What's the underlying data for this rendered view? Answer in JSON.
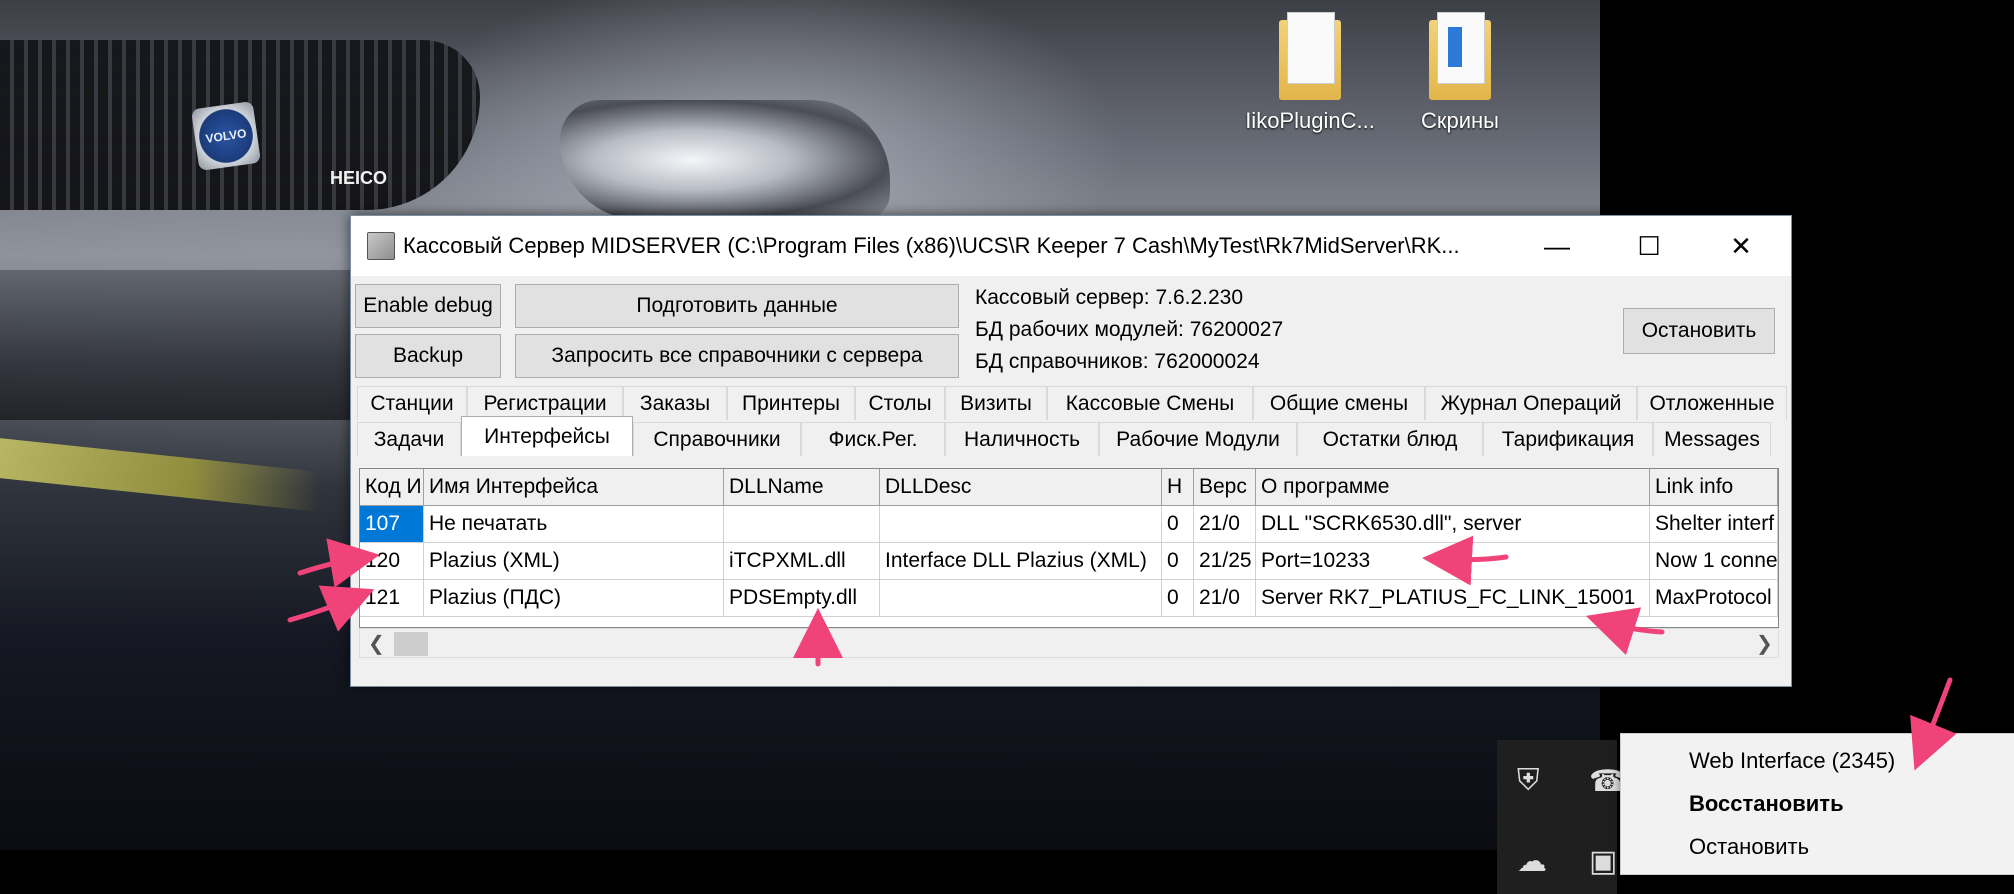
{
  "desktop": {
    "icons": [
      {
        "label": "IikoPluginC..."
      },
      {
        "label": "Скрины"
      }
    ],
    "wallpaper_brand": "HEICO",
    "wallpaper_logo": "VOLVO"
  },
  "window": {
    "title": "Кассовый Сервер MIDSERVER (C:\\Program Files (x86)\\UCS\\R Keeper 7 Cash\\MyTest\\Rk7MidServer\\RK...",
    "controls": {
      "minimize": "—",
      "maximize": "☐",
      "close": "✕"
    },
    "buttons": {
      "enable_debug": "Enable debug",
      "backup": "Backup",
      "prepare_data": "Подготовить данные",
      "request_refs": "Запросить все справочники с сервера",
      "stop": "Остановить"
    },
    "info": {
      "server_version": "Кассовый сервер: 7.6.2.230",
      "db_modules": "БД рабочих модулей: 76200027",
      "db_refs": "БД справочников: 762000024"
    },
    "tabs_row1": [
      "Станции",
      "Регистрации",
      "Заказы",
      "Принтеры",
      "Столы",
      "Визиты",
      "Кассовые Смены",
      "Общие смены",
      "Журнал Операций",
      "Отложенные"
    ],
    "tabs_row2": [
      "Задачи",
      "Интерфейсы",
      "Справочники",
      "Фиск.Рег.",
      "Наличность",
      "Рабочие Модули",
      "Остатки блюд",
      "Тарификация",
      "Messages"
    ],
    "active_tab": "Интерфейсы",
    "grid": {
      "columns": [
        "Код И",
        "Имя Интерфейса",
        "DLLName",
        "DLLDesc",
        "Н",
        "Верс",
        "О программе",
        "Link info"
      ],
      "rows": [
        [
          "107",
          "Не печатать",
          "",
          "",
          "0",
          "21/0",
          "DLL \"SCRK6530.dll\", server",
          "Shelter interf"
        ],
        [
          "120",
          "Plazius (XML)",
          "iTCPXML.dll",
          "Interface DLL Plazius (XML)",
          "0",
          "21/25",
          "Port=10233",
          "Now 1 conne"
        ],
        [
          "121",
          "Plazius (ПДС)",
          "PDSEmpty.dll",
          "",
          "0",
          "21/0",
          "Server RK7_PLATIUS_FC_LINK_15001",
          "MaxProtocol"
        ]
      ]
    }
  },
  "tray_menu": {
    "items": [
      "Web Interface (2345)",
      "Восстановить",
      "Остановить"
    ],
    "bold_item": "Восстановить"
  },
  "colors": {
    "annotation": "#f0437a",
    "selection": "#0078d7"
  }
}
